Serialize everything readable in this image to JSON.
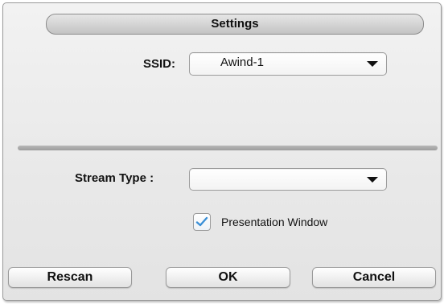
{
  "dialog": {
    "title": "Settings",
    "ssid": {
      "label": "SSID:",
      "value": "Awind-1"
    },
    "stream_type": {
      "label": "Stream Type :",
      "value": ""
    },
    "presentation_window": {
      "label": "Presentation Window",
      "checked": true
    },
    "buttons": {
      "rescan": "Rescan",
      "ok": "OK",
      "cancel": "Cancel"
    }
  },
  "icons": {
    "dropdown": "chevron-down-icon",
    "check": "checkmark-icon"
  },
  "colors": {
    "checkmark": "#3a8fd6"
  }
}
